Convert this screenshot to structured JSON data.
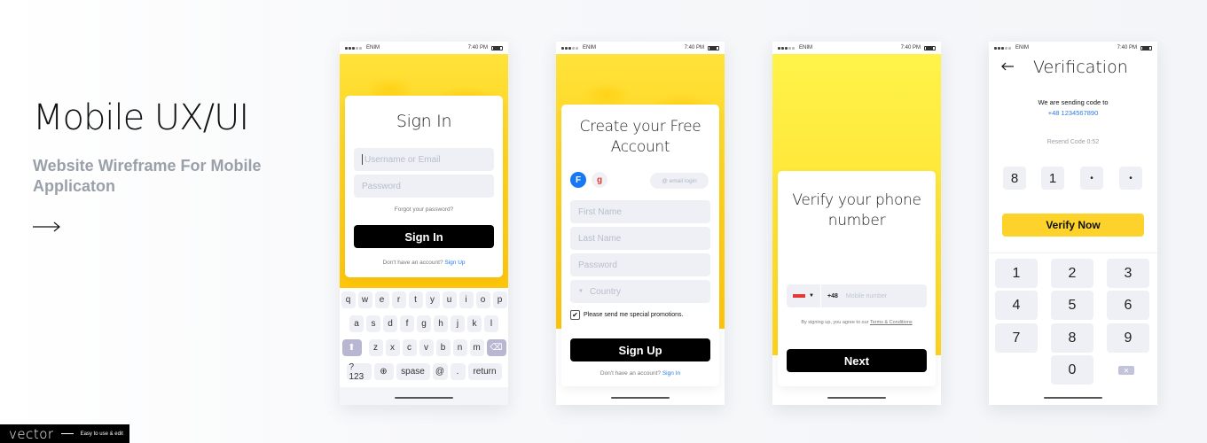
{
  "hero": {
    "title": "Mobile UX/UI",
    "subtitle": "Website Wireframe For Mobile Applicaton",
    "arrow_icon": "arrow-right-icon"
  },
  "badge": {
    "word": "vector",
    "tagline": "Easy to use & edit"
  },
  "status_bar": {
    "carrier": "ENIM",
    "time": "7:40 PM",
    "signal_bars_filled": 3,
    "signal_bars_total": 5
  },
  "signin": {
    "title": "Sign In",
    "username_placeholder": "Username or Email",
    "password_placeholder": "Password",
    "forgot": "Forgot your password?",
    "button": "Sign In",
    "no_account": "Don't have an account?",
    "signup_link": "Sign Up",
    "keyboard": {
      "row1": [
        "q",
        "w",
        "e",
        "r",
        "t",
        "y",
        "u",
        "i",
        "o",
        "p"
      ],
      "row2": [
        "a",
        "s",
        "d",
        "f",
        "g",
        "h",
        "j",
        "k",
        "l"
      ],
      "row3": [
        "z",
        "x",
        "c",
        "v",
        "b",
        "n",
        "m"
      ],
      "numbers": "?123",
      "space": "spase",
      "at": "@",
      "dot": ".",
      "return": "return"
    }
  },
  "signup": {
    "title_line1": "Create your Free",
    "title_line2": "Account",
    "facebook": "F",
    "google": "g",
    "email_login": "@ email login",
    "first_name_placeholder": "First Name",
    "last_name_placeholder": "Last Name",
    "password_placeholder": "Password",
    "country_placeholder": "Country",
    "promo_label": "Please send me special promotions.",
    "promo_checked": true,
    "button": "Sign Up",
    "have_account": "Don't have an account?",
    "signin_link": "Sign In"
  },
  "verify_phone": {
    "title_line1": "Verify your phone",
    "title_line2": "number",
    "prefix": "+48",
    "mobile_placeholder": "Mobile number",
    "terms_prefix": "By signing up, you agree to our",
    "terms_link": "Terms & Conditions",
    "button": "Next"
  },
  "verification": {
    "title": "Verification",
    "sending_to": "We are sending code to",
    "phone": "+48 1234567890",
    "resend": "Resend Code 0:52",
    "code": [
      "8",
      "1",
      "•",
      "•"
    ],
    "button": "Verify Now",
    "numpad": [
      "1",
      "2",
      "3",
      "4",
      "5",
      "6",
      "7",
      "8",
      "9",
      "0"
    ],
    "delete_icon": "backspace-icon"
  },
  "colors": {
    "accent_yellow": "#fdd22a",
    "link_blue": "#2a7be4",
    "facebook_blue": "#1877f2",
    "google_red": "#e53935"
  }
}
